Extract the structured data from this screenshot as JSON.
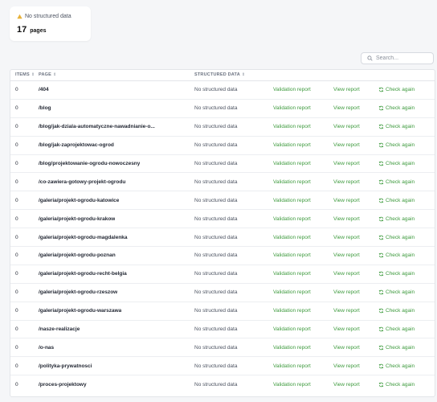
{
  "summary": {
    "status_label": "No structured data",
    "count": "17",
    "unit": "pages",
    "warning_color": "#e8b23a"
  },
  "search": {
    "placeholder": "Search..."
  },
  "table": {
    "headers": {
      "items": "ITEMS",
      "page": "PAGE",
      "structured_data": "STRUCTURED DATA"
    },
    "action_labels": {
      "validation": "Validation report",
      "view": "View report",
      "check": "Check again"
    },
    "rows": [
      {
        "items": "0",
        "page": "/404",
        "structured_data": "No structured data"
      },
      {
        "items": "0",
        "page": "/blog",
        "structured_data": "No structured data"
      },
      {
        "items": "0",
        "page": "/blog/jak-dziala-automatyczne-nawadnianie-o...",
        "structured_data": "No structured data"
      },
      {
        "items": "0",
        "page": "/blog/jak-zaprojektowac-ogrod",
        "structured_data": "No structured data"
      },
      {
        "items": "0",
        "page": "/blog/projektowanie-ogrodu-nowoczesny",
        "structured_data": "No structured data"
      },
      {
        "items": "0",
        "page": "/co-zawiera-gotowy-projekt-ogrodu",
        "structured_data": "No structured data"
      },
      {
        "items": "0",
        "page": "/galeria/projekt-ogrodu-katowice",
        "structured_data": "No structured data"
      },
      {
        "items": "0",
        "page": "/galeria/projekt-ogrodu-krakow",
        "structured_data": "No structured data"
      },
      {
        "items": "0",
        "page": "/galeria/projekt-ogrodu-magdalenka",
        "structured_data": "No structured data"
      },
      {
        "items": "0",
        "page": "/galeria/projekt-ogrodu-poznan",
        "structured_data": "No structured data"
      },
      {
        "items": "0",
        "page": "/galeria/projekt-ogrodu-recht-belgia",
        "structured_data": "No structured data"
      },
      {
        "items": "0",
        "page": "/galeria/projekt-ogrodu-rzeszow",
        "structured_data": "No structured data"
      },
      {
        "items": "0",
        "page": "/galeria/projekt-ogrodu-warszawa",
        "structured_data": "No structured data"
      },
      {
        "items": "0",
        "page": "/nasze-realizacje",
        "structured_data": "No structured data"
      },
      {
        "items": "0",
        "page": "/o-nas",
        "structured_data": "No structured data"
      },
      {
        "items": "0",
        "page": "/polityka-prywatnosci",
        "structured_data": "No structured data"
      },
      {
        "items": "0",
        "page": "/proces-projektowy",
        "structured_data": "No structured data"
      }
    ]
  },
  "colors": {
    "link": "#3d9a3d"
  }
}
